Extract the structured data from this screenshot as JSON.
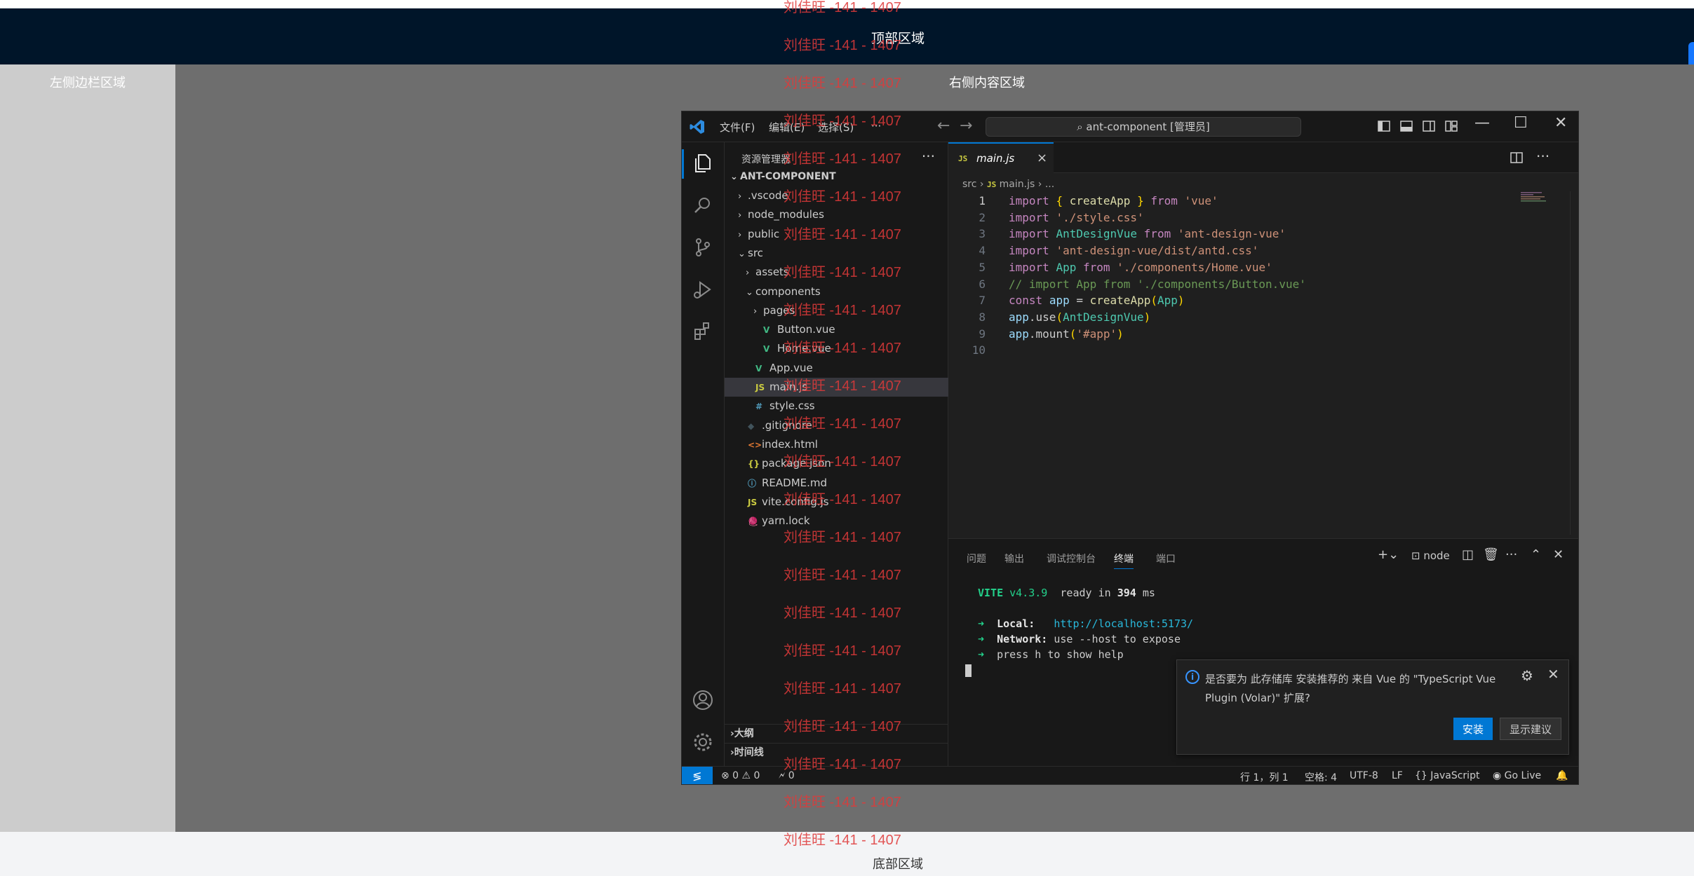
{
  "layout_labels": {
    "header": "顶部区域",
    "sidebar": "左侧边栏区域",
    "content": "右侧内容区域",
    "footer": "底部区域"
  },
  "watermark": "刘佳旺 -141 - 1407",
  "vscode": {
    "menus": [
      "文件(F)",
      "编辑(E)",
      "选择(S)",
      "···"
    ],
    "search": "ant-component [管理员]",
    "explorer": {
      "title": "资源管理器",
      "more": "···",
      "root": "ANT-COMPONENT",
      "tree": [
        {
          "label": ".vscode",
          "chev": "›",
          "icon": ""
        },
        {
          "label": "node_modules",
          "chev": "›",
          "icon": ""
        },
        {
          "label": "public",
          "chev": "›",
          "icon": ""
        },
        {
          "label": "src",
          "chev": "⌄",
          "icon": ""
        },
        {
          "label": "assets",
          "chev": "›",
          "icon": ""
        },
        {
          "label": "components",
          "chev": "⌄",
          "icon": ""
        },
        {
          "label": "pages",
          "chev": "›",
          "icon": ""
        },
        {
          "label": "Button.vue",
          "chev": "",
          "icon": "V"
        },
        {
          "label": "Home.vue",
          "chev": "",
          "icon": "V"
        },
        {
          "label": "App.vue",
          "chev": "",
          "icon": "V"
        },
        {
          "label": "main.js",
          "chev": "",
          "icon": "JS"
        },
        {
          "label": "style.css",
          "chev": "",
          "icon": "#"
        },
        {
          "label": ".gitignore",
          "chev": "",
          "icon": "◆"
        },
        {
          "label": "index.html",
          "chev": "",
          "icon": "<>"
        },
        {
          "label": "package.json",
          "chev": "",
          "icon": "{}"
        },
        {
          "label": "README.md",
          "chev": "",
          "icon": "ⓘ"
        },
        {
          "label": "vite.config.js",
          "chev": "",
          "icon": "JS"
        },
        {
          "label": "yarn.lock",
          "chev": "",
          "icon": "🧶"
        }
      ],
      "outline": "大纲",
      "timeline": "时间线"
    },
    "tab": {
      "badge": "JS",
      "label": "main.js",
      "close": "×"
    },
    "breadcrumb": [
      "src",
      "main.js",
      "..."
    ],
    "code_lines": [
      "import { createApp } from 'vue'",
      "import './style.css'",
      "import AntDesignVue from 'ant-design-vue'",
      "import 'ant-design-vue/dist/antd.css'",
      "import App from './components/Home.vue'",
      "// import App from './components/Button.vue'",
      "const app = createApp(App)",
      "app.use(AntDesignVue)",
      "app.mount('#app')",
      ""
    ],
    "panel_tabs": [
      "问题",
      "输出",
      "调试控制台",
      "终端",
      "端口"
    ],
    "terminal_name": "node",
    "terminal": {
      "vite": "VITE",
      "version": "v4.3.9",
      "ready": "ready in",
      "ms_value": "394",
      "ms": "ms",
      "local_label": "Local:",
      "local_url": "http://localhost:5173/",
      "network_label": "Network:",
      "network_text": "use --host to expose",
      "help": "press h to show help"
    },
    "notification": {
      "text": "是否要为 此存储库 安装推荐的 来自 Vue 的 \"TypeScript Vue Plugin (Volar)\" 扩展?",
      "install": "安装",
      "show": "显示建议"
    },
    "status": {
      "problems": "⊗ 0 ⚠ 0",
      "ports": "🗲 0",
      "position": "行 1，列 1",
      "spaces": "空格: 4",
      "encoding": "UTF-8",
      "eol": "LF",
      "language": "{} JavaScript",
      "golive": "Go Live"
    }
  }
}
